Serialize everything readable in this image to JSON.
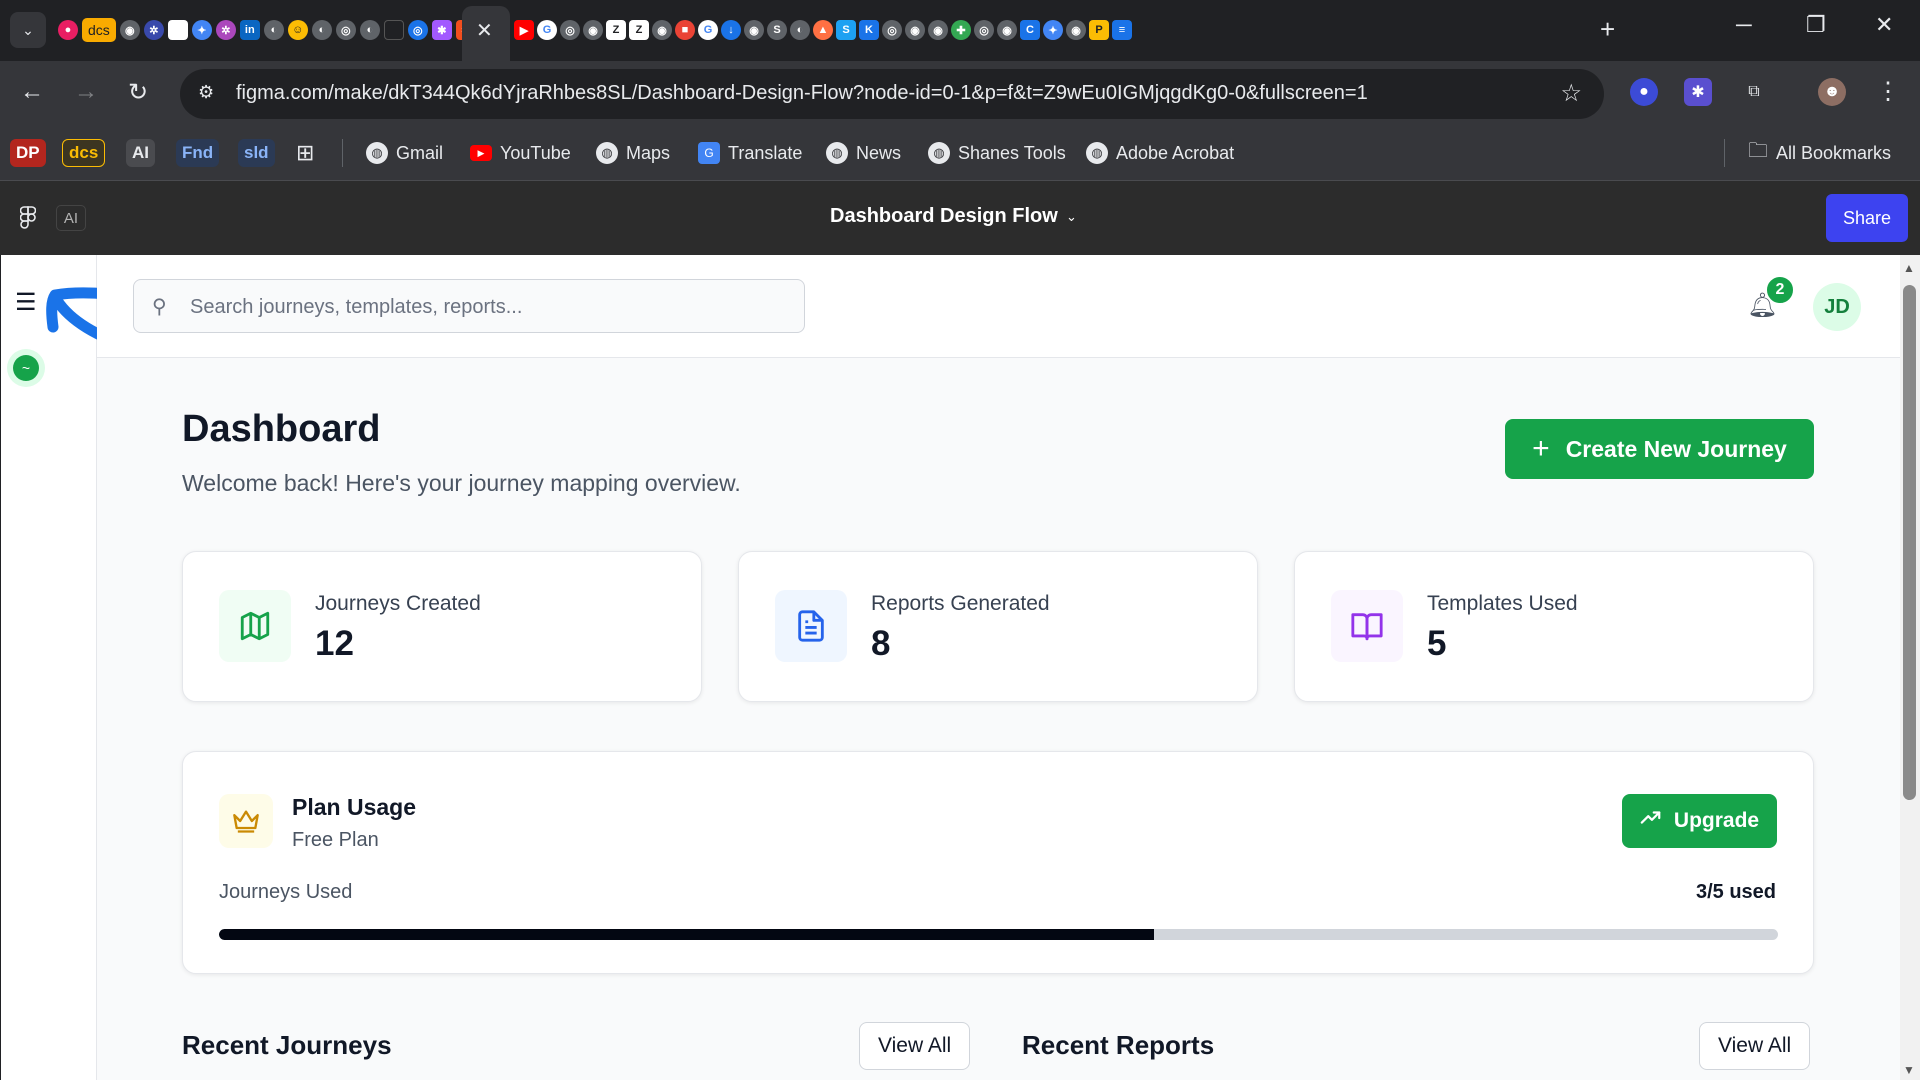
{
  "browser": {
    "tab_chip_label": "dcs",
    "url": "figma.com/make/dkT344Qk6dYjraRhbes8SL/Dashboard-Design-Flow?node-id=0-1&p=f&t=Z9wEu0IGMjqgdKg0-0&fullscreen=1",
    "bookmarks": {
      "chips": [
        "DP",
        "dcs",
        "AI",
        "Fnd",
        "sld"
      ],
      "links": [
        "Gmail",
        "YouTube",
        "Maps",
        "Translate",
        "News",
        "Shanes Tools",
        "Adobe Acrobat"
      ],
      "all_bookmarks": "All Bookmarks"
    }
  },
  "figma": {
    "ai_label": "AI",
    "file_title": "Dashboard Design Flow",
    "share_label": "Share"
  },
  "app": {
    "search": {
      "placeholder": "Search journeys, templates, reports..."
    },
    "notifications": {
      "count": "2"
    },
    "avatar_initials": "JD",
    "header": {
      "title": "Dashboard",
      "subtitle": "Welcome back! Here's your journey mapping overview.",
      "create_button": "Create New Journey"
    },
    "stats": [
      {
        "label": "Journeys Created",
        "value": "12",
        "icon": "map-icon",
        "color": "#16a34a",
        "bg": "#f0fdf4"
      },
      {
        "label": "Reports Generated",
        "value": "8",
        "icon": "document-icon",
        "color": "#2563eb",
        "bg": "#eff6ff"
      },
      {
        "label": "Templates Used",
        "value": "5",
        "icon": "book-open-icon",
        "color": "#9333ea",
        "bg": "#faf5ff"
      }
    ],
    "plan": {
      "title": "Plan Usage",
      "plan_name": "Free Plan",
      "upgrade_label": "Upgrade",
      "usage_label": "Journeys Used",
      "usage_text": "3/5 used",
      "usage_fraction": 0.6
    },
    "sections": {
      "recent_journeys": "Recent Journeys",
      "recent_reports": "Recent Reports",
      "view_all": "View All"
    },
    "colors": {
      "accent": "#16a34a",
      "share": "#3d43f0",
      "annotation": "#1a73e8"
    }
  }
}
